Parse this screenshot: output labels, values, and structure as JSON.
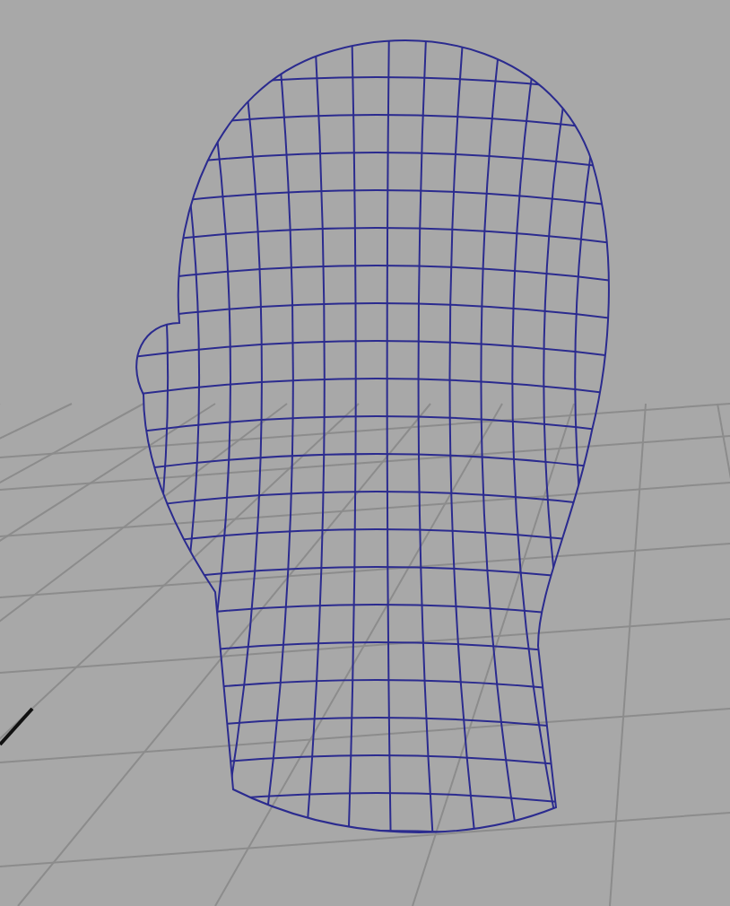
{
  "viewport": {
    "grid": true
  },
  "mesh": {
    "selected": false
  }
}
